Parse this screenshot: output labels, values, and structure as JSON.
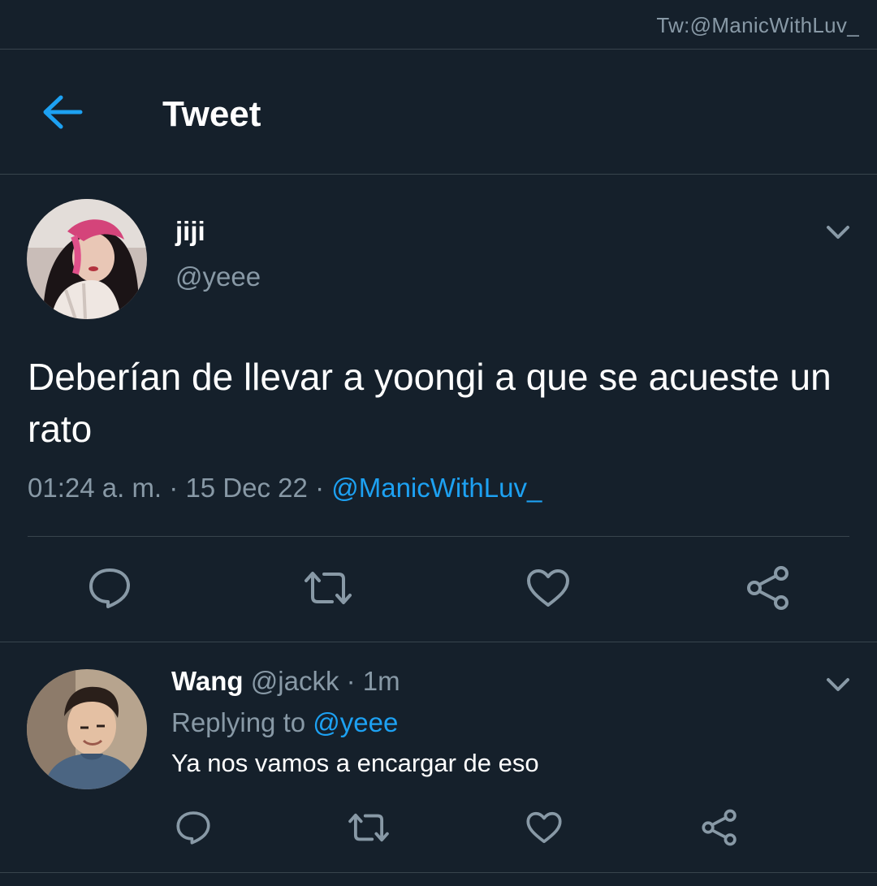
{
  "watermark": "Tw:@ManicWithLuv_",
  "header": {
    "title": "Tweet"
  },
  "tweet": {
    "name": "jiji",
    "handle": "@yeee",
    "text": "Deberían de llevar a yoongi a que se acueste un rato",
    "time": "01:24 a. m.",
    "separator": "·",
    "date": "15 Dec 22",
    "source": "@ManicWithLuv_"
  },
  "reply": {
    "name": "Wang",
    "handle": "@jackk",
    "separator": "·",
    "age": "1m",
    "replying_prefix": "Replying to",
    "replying_to": "@yeee",
    "text": "Ya nos vamos a encargar de eso"
  },
  "icons": {
    "back": "arrow-left-icon",
    "more": "chevron-down-icon",
    "reply": "speech-bubble-icon",
    "retweet": "retweet-icon",
    "like": "heart-icon",
    "share": "share-icon"
  },
  "colors": {
    "background": "#15202b",
    "divider": "#38444d",
    "accent": "#1da1f2",
    "muted": "#8899a6",
    "text": "#ffffff"
  }
}
